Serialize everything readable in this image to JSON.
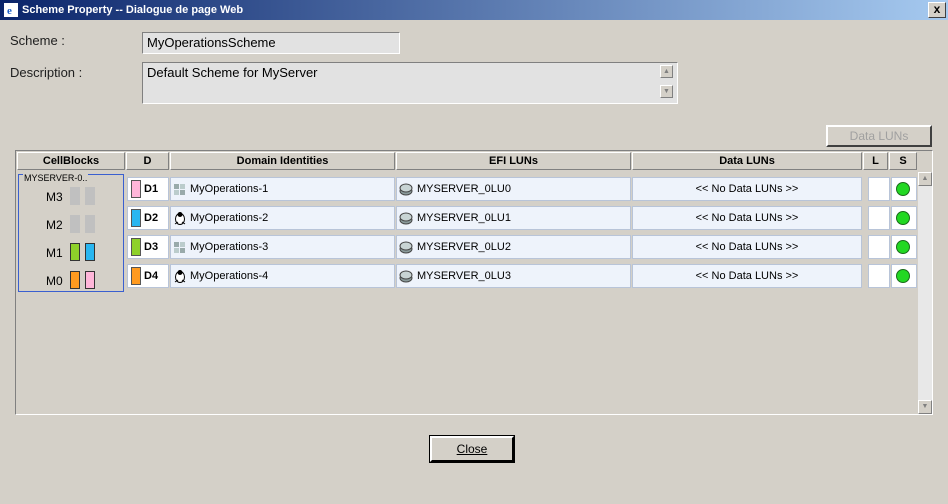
{
  "window": {
    "title": "Scheme Property -- Dialogue de page Web",
    "close_label": "x"
  },
  "form": {
    "scheme_label": "Scheme :",
    "scheme_value": "MyOperationsScheme",
    "description_label": "Description :",
    "description_value": "Default Scheme for MyServer"
  },
  "toolbar": {
    "data_luns_button": "Data LUNs"
  },
  "table": {
    "headers": {
      "cellblocks": "CellBlocks",
      "d": "D",
      "domain": "Domain Identities",
      "efi": "EFI LUNs",
      "data": "Data LUNs",
      "l": "L",
      "s": "S"
    },
    "rows": [
      {
        "d": "D1",
        "color": "#ffb6d9",
        "icon": "windows-server-icon",
        "domain": "MyOperations-1",
        "efi": "MYSERVER_0LU0",
        "data": "<< No Data LUNs >>",
        "status_color": "#22d822"
      },
      {
        "d": "D2",
        "color": "#29b6f0",
        "icon": "linux-icon",
        "domain": "MyOperations-2",
        "efi": "MYSERVER_0LU1",
        "data": "<< No Data LUNs >>",
        "status_color": "#22d822"
      },
      {
        "d": "D3",
        "color": "#8ed12a",
        "icon": "windows-server-icon",
        "domain": "MyOperations-3",
        "efi": "MYSERVER_0LU2",
        "data": "<< No Data LUNs >>",
        "status_color": "#22d822"
      },
      {
        "d": "D4",
        "color": "#ff9a1f",
        "icon": "linux-icon",
        "domain": "MyOperations-4",
        "efi": "MYSERVER_0LU3",
        "data": "<< No Data LUNs >>",
        "status_color": "#22d822"
      }
    ]
  },
  "cellblocks": {
    "title": "MYSERVER-0..",
    "modules": [
      {
        "label": "M3",
        "slots": [
          "empty",
          "empty"
        ]
      },
      {
        "label": "M2",
        "slots": [
          "empty",
          "empty"
        ]
      },
      {
        "label": "M1",
        "slots": [
          "#8ed12a",
          "#29b6f0"
        ]
      },
      {
        "label": "M0",
        "slots": [
          "#ff9a1f",
          "#ffb6d9"
        ]
      }
    ]
  },
  "footer": {
    "close_button": "Close"
  }
}
